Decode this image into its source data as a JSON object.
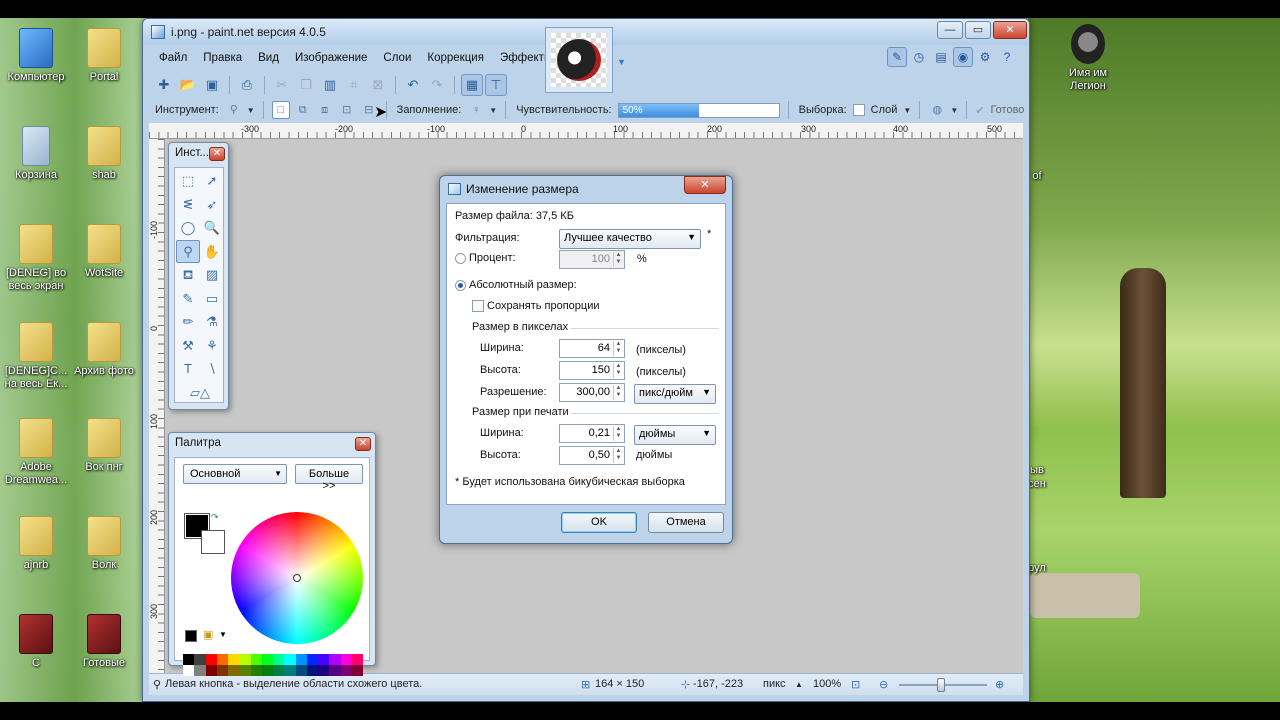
{
  "desktop": {
    "icons": [
      {
        "label": "Компьютер",
        "type": "pc"
      },
      {
        "label": "Portal",
        "type": "folder"
      },
      {
        "label": "Корзина",
        "type": "bin"
      },
      {
        "label": "shab",
        "type": "folder"
      },
      {
        "label": "[DENEG] во весь экран",
        "type": "folder"
      },
      {
        "label": "WotSite",
        "type": "folder"
      },
      {
        "label": "[DENEG]С... на весь Ек...",
        "type": "folder"
      },
      {
        "label": "Архив фото",
        "type": "folder"
      },
      {
        "label": "Adobe Dreamwea...",
        "type": "folder"
      },
      {
        "label": "Вок пнг",
        "type": "folder"
      },
      {
        "label": "ajnrb",
        "type": "folder"
      },
      {
        "label": "Волк",
        "type": "folder"
      },
      {
        "label": "C",
        "type": "red"
      },
      {
        "label": "Готовые",
        "type": "red"
      },
      {
        "label": "Имя им Легион",
        "type": "dark"
      }
    ],
    "right_edge_text": [
      "of",
      "ыв",
      "сен",
      "рул"
    ]
  },
  "window": {
    "title": "i.png - paint.net версия 4.0.5",
    "controls": {
      "minimize": "—",
      "maximize": "▭",
      "close": "✕"
    },
    "menu": [
      "Файл",
      "Правка",
      "Вид",
      "Изображение",
      "Слои",
      "Коррекция",
      "Эффекты"
    ],
    "toolbar2": {
      "tool_label": "Инструмент:",
      "fill_label": "Заполнение:",
      "tolerance_label": "Чувствительность:",
      "tolerance_value": "50%",
      "tolerance_fraction": 0.5,
      "sampling_label": "Выборка:",
      "sampling_value": "Слой",
      "done_label": "Готово"
    },
    "ruler_h": [
      "-300",
      "-200",
      "-100",
      "0",
      "100",
      "200",
      "300",
      "400",
      "500"
    ],
    "ruler_v": [
      "-100",
      "0",
      "100",
      "200",
      "300"
    ],
    "status": {
      "hint": "Левая кнопка - выделение области схожего цвета.",
      "size": "164 × 150",
      "coords": "-167, -223",
      "units": "пикс",
      "zoom": "100%"
    }
  },
  "tools_window": {
    "title": "Инст..."
  },
  "palette_window": {
    "title": "Палитра",
    "mode": "Основной",
    "more_button": "Больше >>",
    "swatches": [
      "#000000",
      "#404040",
      "#ff0000",
      "#ff6a00",
      "#ffd800",
      "#b6ff00",
      "#4cff00",
      "#00ff21",
      "#00ff90",
      "#00ffff",
      "#0094ff",
      "#0026ff",
      "#4800ff",
      "#b200ff",
      "#ff00dc",
      "#ff006e",
      "#ffffff",
      "#808080",
      "#7f0000",
      "#7f3300",
      "#7f6a00",
      "#5b7f00",
      "#267f00",
      "#007f0e",
      "#007f46",
      "#007f7f",
      "#004a7f",
      "#00137f",
      "#21007f",
      "#57007f",
      "#7f006e",
      "#7f0037"
    ]
  },
  "dialog": {
    "title": "Изменение размера",
    "filesize": "Размер файла: 37,5 КБ",
    "filter_label": "Фильтрация:",
    "filter_value": "Лучшее качество",
    "asterisk": "*",
    "percent_label": "Процент:",
    "percent_value": "100",
    "percent_unit": "%",
    "absolute_label": "Абсолютный размер:",
    "keep_ratio_label": "Сохранять пропорции",
    "pixel_group": "Размер в пикселах",
    "width_label": "Ширина:",
    "width_px": "64",
    "height_label": "Высота:",
    "height_px": "150",
    "pixels_unit": "(пикселы)",
    "resolution_label": "Разрешение:",
    "resolution_value": "300,00",
    "resolution_unit": "пикс/дюйм",
    "print_group": "Размер при печати",
    "print_width_label": "Ширина:",
    "print_width": "0,21",
    "print_unit": "дюймы",
    "print_height_label": "Высота:",
    "print_height": "0,50",
    "print_height_unit": "дюймы",
    "note": "* Будет использована бикубическая выборка",
    "ok": "OK",
    "cancel": "Отмена"
  }
}
